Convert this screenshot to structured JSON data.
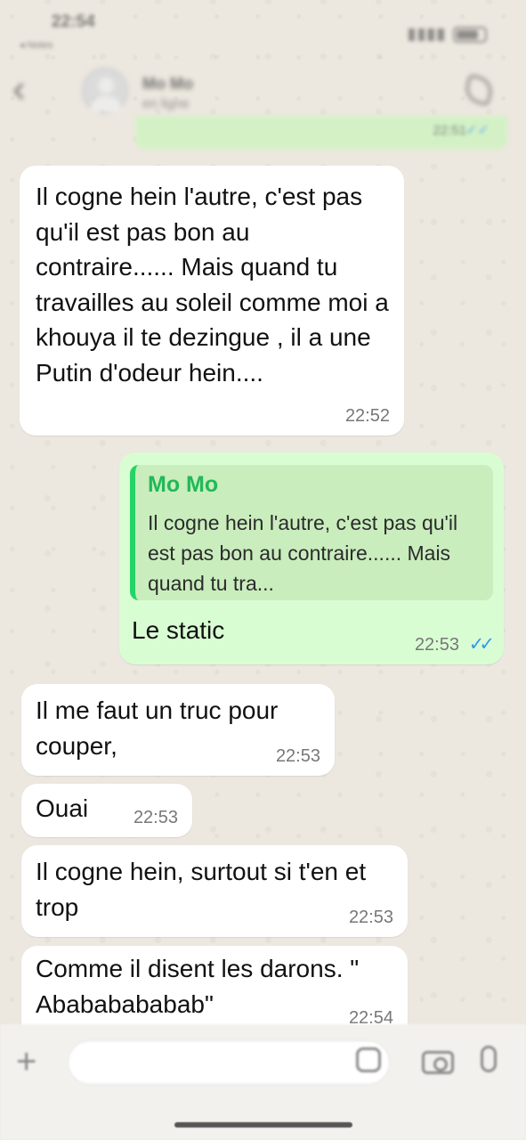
{
  "status_bar": {
    "time": "22:54",
    "back_app": "◂ Notes"
  },
  "header": {
    "contact_name": "Mo Mo",
    "contact_status": "en ligne"
  },
  "top_message": {
    "time": "22:51"
  },
  "messages": [
    {
      "direction": "in",
      "text": "Il cogne hein l'autre, c'est pas qu'il est pas bon au contraire...... Mais quand tu travailles au soleil comme moi a khouya il te dezingue , il a une Putin d'odeur hein....",
      "time": "22:52"
    },
    {
      "direction": "out",
      "quote_author": "Mo Mo",
      "quote_text": "Il cogne hein l'autre, c'est pas qu'il est pas bon au contraire...... Mais quand tu tra...",
      "text": "Le static",
      "time": "22:53",
      "status": "read"
    },
    {
      "direction": "in",
      "text": "Il me faut un truc pour couper,",
      "time": "22:53"
    },
    {
      "direction": "in",
      "text": "Ouai",
      "time": "22:53"
    },
    {
      "direction": "in",
      "text": "Il cogne hein, surtout si t'en et trop",
      "time": "22:53"
    },
    {
      "direction": "in",
      "text": "Comme il disent les darons. \" Abababababab\"",
      "time": "22:54"
    }
  ],
  "colors": {
    "incoming_bubble": "#ffffff",
    "outgoing_bubble": "#d9fdd3",
    "quote_accent": "#25d366",
    "read_ticks": "#3498f0"
  },
  "icons": [
    "back-chevron-icon",
    "avatar",
    "call-icon",
    "plus-icon",
    "sticker-icon",
    "camera-icon",
    "microphone-icon",
    "double-check-icon"
  ]
}
